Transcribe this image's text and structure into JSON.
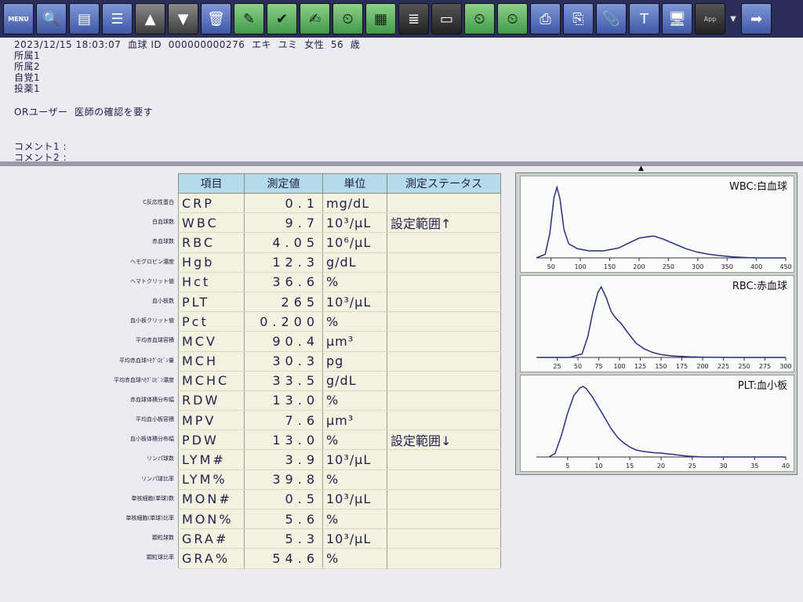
{
  "toolbar": {
    "menu_label": "MENU",
    "app_label": "App",
    "buttons": [
      "search-icon",
      "document-icon",
      "list-icon",
      "up-arrow-icon",
      "down-arrow-icon",
      "trash-icon",
      "edit-or-icon",
      "check-or-icon",
      "note-icon",
      "clock-check-icon",
      "grid-icon",
      "lines-icon",
      "ruler-icon",
      "clock-doc-icon",
      "clock-chart-icon",
      "print-icon",
      "print-copy-icon",
      "paperclip-icon",
      "text-icon",
      "monitor-icon"
    ]
  },
  "patient": {
    "line": "2023/12/15 18:03:07  血球 ID  000000000276  エキ  ユミ  女性  56  歳",
    "affil1": "所属1",
    "affil2": "所属2",
    "symptom1": "自覚1",
    "medication1": "投薬1",
    "or_note": "ORユーザー  医師の確認を要す",
    "comment1": "コメント1 :",
    "comment2": "コメント2 :"
  },
  "table": {
    "headers": [
      "項目",
      "測定値",
      "単位",
      "測定ステータス"
    ],
    "rows": [
      {
        "label": "C反応性蛋白",
        "item": "CRP",
        "value": "0.1",
        "unit": "mg/dL",
        "status": ""
      },
      {
        "label": "白血球数",
        "item": "WBC",
        "value": "9.7",
        "unit": "10³/μL",
        "status": "設定範囲↑"
      },
      {
        "label": "赤血球数",
        "item": "RBC",
        "value": "4.05",
        "unit": "10⁶/μL",
        "status": ""
      },
      {
        "label": "ヘモグロビン濃度",
        "item": "Hgb",
        "value": "12.3",
        "unit": "g/dL",
        "status": ""
      },
      {
        "label": "ヘマトクリット値",
        "item": "Hct",
        "value": "36.6",
        "unit": "%",
        "status": ""
      },
      {
        "label": "血小板数",
        "item": "PLT",
        "value": "265",
        "unit": "10³/μL",
        "status": ""
      },
      {
        "label": "血小板クリット値",
        "item": "Pct",
        "value": "0.200",
        "unit": "%",
        "status": ""
      },
      {
        "label": "平均赤血球容積",
        "item": "MCV",
        "value": "90.4",
        "unit": "μm³",
        "status": ""
      },
      {
        "label": "平均赤血球ﾍﾓｸﾞﾛﾋﾞﾝ量",
        "item": "MCH",
        "value": "30.3",
        "unit": "pg",
        "status": ""
      },
      {
        "label": "平均赤血球ﾍﾓｸﾞﾛﾋﾞﾝ濃度",
        "item": "MCHC",
        "value": "33.5",
        "unit": "g/dL",
        "status": ""
      },
      {
        "label": "赤血球体積分布幅",
        "item": "RDW",
        "value": "13.0",
        "unit": "%",
        "status": ""
      },
      {
        "label": "平均血小板容積",
        "item": "MPV",
        "value": "7.6",
        "unit": "μm³",
        "status": ""
      },
      {
        "label": "血小板体積分布幅",
        "item": "PDW",
        "value": "13.0",
        "unit": "%",
        "status": "設定範囲↓"
      },
      {
        "label": "リンパ球数",
        "item": "LYM#",
        "value": "3.9",
        "unit": "10³/μL",
        "status": ""
      },
      {
        "label": "リンパ球比率",
        "item": "LYM%",
        "value": "39.8",
        "unit": "%",
        "status": ""
      },
      {
        "label": "単核細胞(単球)数",
        "item": "MON#",
        "value": "0.5",
        "unit": "10³/μL",
        "status": ""
      },
      {
        "label": "単核細胞(単球)比率",
        "item": "MON%",
        "value": "5.6",
        "unit": "%",
        "status": ""
      },
      {
        "label": "顆粒球数",
        "item": "GRA#",
        "value": "5.3",
        "unit": "10³/μL",
        "status": ""
      },
      {
        "label": "顆粒球比率",
        "item": "GRA%",
        "value": "54.6",
        "unit": "%",
        "status": ""
      }
    ]
  },
  "histograms": [
    {
      "title": "WBC:白血球",
      "ticks": [
        50,
        100,
        150,
        200,
        250,
        300,
        350,
        400,
        450
      ],
      "xmin": 25,
      "xmax": 450,
      "curve": [
        [
          25,
          0
        ],
        [
          40,
          0.05
        ],
        [
          48,
          0.35
        ],
        [
          55,
          0.85
        ],
        [
          60,
          1.0
        ],
        [
          65,
          0.85
        ],
        [
          72,
          0.4
        ],
        [
          80,
          0.2
        ],
        [
          95,
          0.13
        ],
        [
          115,
          0.1
        ],
        [
          140,
          0.1
        ],
        [
          165,
          0.14
        ],
        [
          185,
          0.22
        ],
        [
          200,
          0.28
        ],
        [
          215,
          0.3
        ],
        [
          225,
          0.31
        ],
        [
          240,
          0.27
        ],
        [
          260,
          0.2
        ],
        [
          280,
          0.13
        ],
        [
          300,
          0.08
        ],
        [
          320,
          0.05
        ],
        [
          340,
          0.03
        ],
        [
          360,
          0.015
        ],
        [
          380,
          0.005
        ],
        [
          400,
          0
        ],
        [
          450,
          0
        ]
      ]
    },
    {
      "title": "RBC:赤血球",
      "ticks": [
        25,
        50,
        75,
        100,
        125,
        150,
        175,
        200,
        225,
        250,
        275,
        300
      ],
      "xmin": 0,
      "xmax": 300,
      "curve": [
        [
          0,
          0
        ],
        [
          40,
          0
        ],
        [
          55,
          0.05
        ],
        [
          62,
          0.3
        ],
        [
          68,
          0.65
        ],
        [
          74,
          0.92
        ],
        [
          78,
          1.0
        ],
        [
          84,
          0.85
        ],
        [
          90,
          0.65
        ],
        [
          96,
          0.55
        ],
        [
          102,
          0.48
        ],
        [
          110,
          0.35
        ],
        [
          120,
          0.2
        ],
        [
          130,
          0.12
        ],
        [
          140,
          0.07
        ],
        [
          150,
          0.04
        ],
        [
          165,
          0.02
        ],
        [
          185,
          0.008
        ],
        [
          205,
          0.003
        ],
        [
          240,
          0
        ],
        [
          300,
          0
        ]
      ]
    },
    {
      "title": "PLT:血小板",
      "ticks": [
        5,
        10,
        15,
        20,
        25,
        30,
        35,
        40
      ],
      "xmin": 0,
      "xmax": 40,
      "curve": [
        [
          2,
          0
        ],
        [
          3,
          0.05
        ],
        [
          4,
          0.3
        ],
        [
          5,
          0.62
        ],
        [
          6,
          0.87
        ],
        [
          7,
          0.98
        ],
        [
          7.5,
          1.0
        ],
        [
          8,
          0.97
        ],
        [
          9,
          0.85
        ],
        [
          10,
          0.7
        ],
        [
          11,
          0.55
        ],
        [
          12,
          0.4
        ],
        [
          13,
          0.28
        ],
        [
          14,
          0.2
        ],
        [
          15,
          0.14
        ],
        [
          16,
          0.1
        ],
        [
          17,
          0.08
        ],
        [
          18,
          0.07
        ],
        [
          19,
          0.06
        ],
        [
          20,
          0.055
        ],
        [
          21,
          0.045
        ],
        [
          22,
          0.035
        ],
        [
          23,
          0.025
        ],
        [
          24,
          0.015
        ],
        [
          25,
          0.008
        ],
        [
          27,
          0
        ],
        [
          40,
          0
        ]
      ]
    }
  ]
}
